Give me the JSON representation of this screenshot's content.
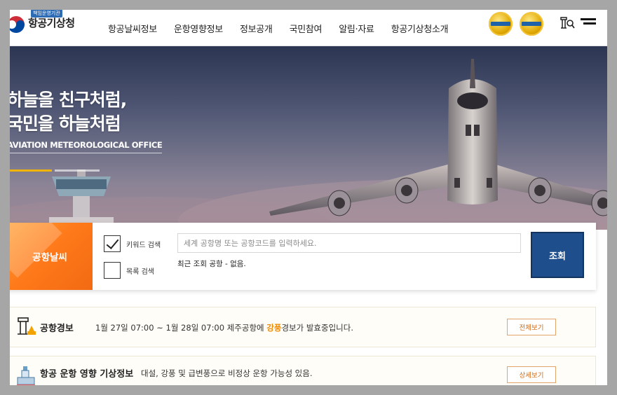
{
  "header": {
    "org_badge": "책임운영기관",
    "org_name": "항공기상청",
    "nav": [
      "항공날씨정보",
      "운항영향정보",
      "정보공개",
      "국민참여",
      "알림·자료",
      "항공기상청소개"
    ]
  },
  "hero": {
    "title_line1": "하늘을 친구처럼,",
    "title_line2": "국민을 하늘처럼",
    "subtitle": "AVIATION METEOROLOGICAL OFFICE"
  },
  "search": {
    "tab_label": "공항날씨",
    "keyword_label": "키워드 검색",
    "keyword_checked": true,
    "list_label": "목록 검색",
    "list_checked": false,
    "placeholder": "세계 공항명 또는 공항코드를 입력하세요.",
    "recent_text": "최근 조회 공항 - 없음.",
    "button_label": "조회"
  },
  "alerts": {
    "title": "공항경보",
    "text_before": "1월 27일 07:00 ~ 1월 28일 07:00 제주공항에 ",
    "highlight": "강풍",
    "text_after": "경보가 발효중입니다.",
    "button_label": "전체보기"
  },
  "impact": {
    "title": "항공 운항 영향 기상정보",
    "text": "대설, 강풍 및 급변풍으로 비정상 운항 가능성 있음.",
    "button_label": "상세보기"
  },
  "colors": {
    "accent_orange": "#f26a12",
    "button_navy": "#1f4e8c",
    "highlight": "#f08a00"
  }
}
